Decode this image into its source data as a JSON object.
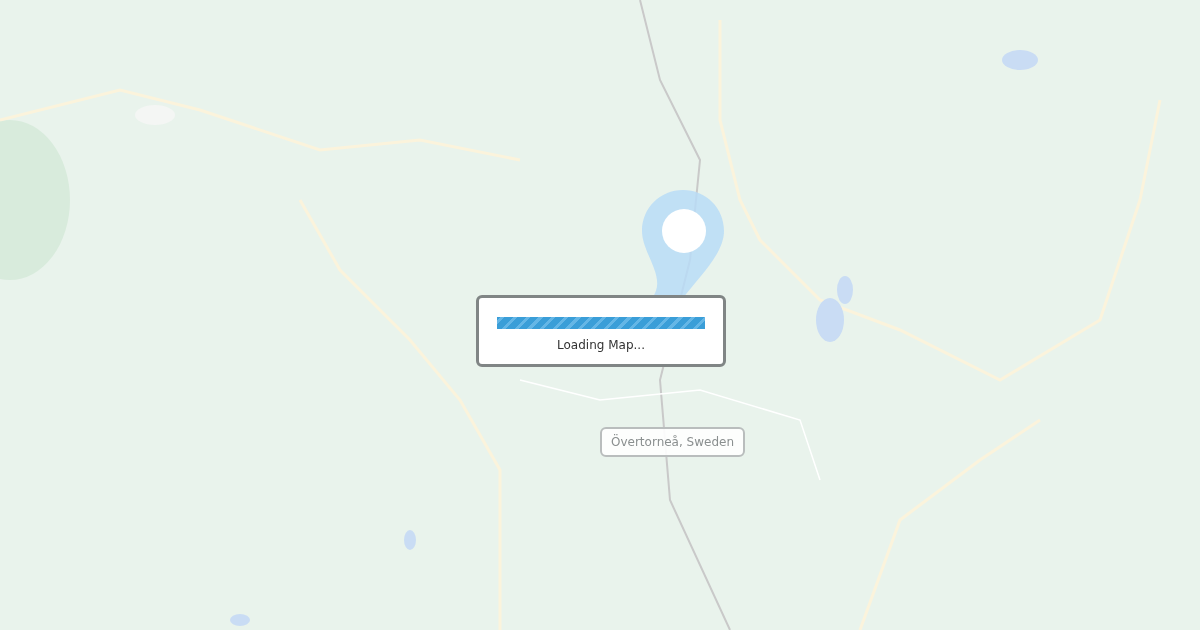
{
  "location_label": "Övertorneå, Sweden",
  "loading_dialog": {
    "progress": {
      "level": 1
    },
    "message": "Loading Map..."
  }
}
